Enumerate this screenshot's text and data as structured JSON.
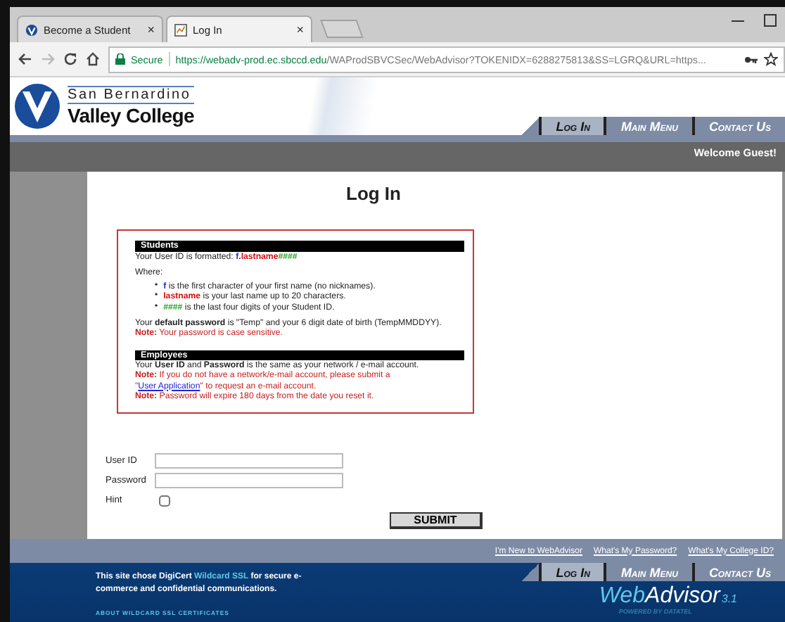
{
  "browser": {
    "tabs": [
      {
        "title": "Become a Student",
        "close": "×",
        "selected": false
      },
      {
        "title": "Log In",
        "close": "×",
        "selected": true
      }
    ],
    "secure_label": "Secure",
    "url_host": "https://webadv-prod.ec.sbccd.edu",
    "url_path": "/WAProdSBVCSec/WebAdvisor?TOKENIDX=6288275813&SS=LGRQ&URL=https..."
  },
  "header": {
    "college_name": [
      "San Bernardino",
      "Valley College"
    ],
    "nav": [
      {
        "label": "Log In",
        "selected": true
      },
      {
        "label": "Main Menu",
        "selected": false
      },
      {
        "label": "Contact Us",
        "selected": false
      }
    ],
    "welcome": "Welcome Guest!"
  },
  "login": {
    "title": "Log In",
    "students": {
      "heading": "Students",
      "format_intro": "Your User ID is formatted: ",
      "format_parts": [
        {
          "text": "f.",
          "kind": "first"
        },
        {
          "text": "lastname",
          "kind": "last"
        },
        {
          "text": "####",
          "kind": "digits"
        }
      ],
      "where": "Where:",
      "bullets": [
        {
          "marker": "•",
          "term": "f",
          "text": " is the first character of your first name (no nicknames).",
          "kind": "first"
        },
        {
          "marker": "•",
          "term": "lastname",
          "text": " is your last name up to 20 characters.",
          "kind": "last"
        },
        {
          "marker": "•",
          "term": "####",
          "text": " is the last four digits of your Student ID.",
          "kind": "digits"
        }
      ],
      "password_text": "Your **default password** is \"Temp\" and your 6 digit date of birth (TempMMDDYY).",
      "note": {
        "label": "Note:",
        "text": " Your password is case sensitive."
      }
    },
    "employees": {
      "heading": "Employees",
      "text": "Your **User ID** and **Password** is the same as your network / e-mail account.",
      "note_account": {
        "label": "Note:",
        "text": " If you do not have a network/e-mail account, please submit a",
        "quote_open": "\"",
        "link": "User Application",
        "text_after": "\" to request an e-mail account."
      },
      "note_expire": {
        "label": "Note:",
        "text": " Password will expire 180 days from the date you reset it."
      }
    },
    "fields": [
      {
        "label": "User ID",
        "kind": "text"
      },
      {
        "label": "Password",
        "kind": "password"
      },
      {
        "label": "Hint",
        "kind": "checkbox",
        "checked": false
      }
    ],
    "submit": "SUBMIT"
  },
  "footer": {
    "links": [
      "I'm New to WebAdvisor",
      "What's My Password?",
      "What's My College ID?"
    ],
    "ssl_before": "This site chose DigiCert ",
    "ssl_link": "Wildcard SSL",
    "ssl_after": " for secure e-commerce and confidential communications.",
    "about": "ABOUT WILDCARD SSL CERTIFICATES",
    "nav": [
      {
        "label": "Log In",
        "selected": true
      },
      {
        "label": "Main Menu",
        "selected": false
      },
      {
        "label": "Contact Us",
        "selected": false
      }
    ],
    "logo_web": "Web",
    "logo_advisor": "Advisor",
    "logo_version": "3.1",
    "logo_powered": "POWERED BY DATATEL"
  }
}
